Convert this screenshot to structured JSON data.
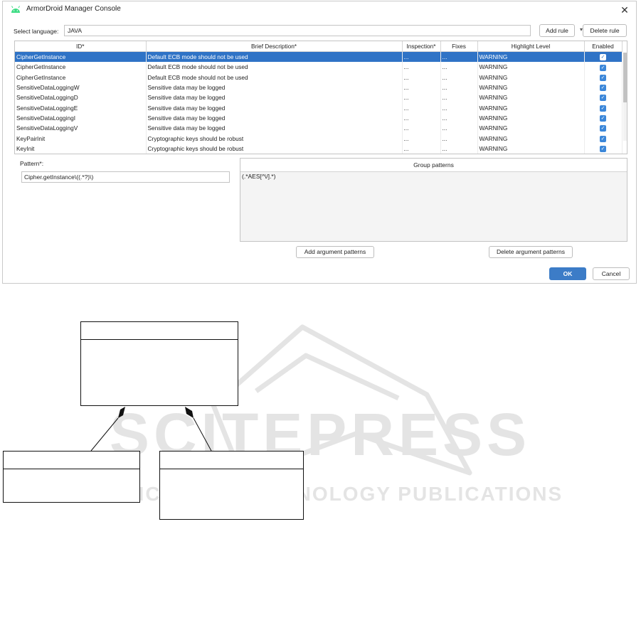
{
  "window": {
    "title": "ArmorDroid Manager Console",
    "close_glyph": "✕",
    "icon": "android-icon"
  },
  "language": {
    "label": "Select language:",
    "value": "JAVA",
    "dropdown_glyph": "▾"
  },
  "buttons": {
    "add_rule": "Add rule",
    "delete_rule": "Delete rule",
    "add_argument_patterns": "Add argument patterns",
    "delete_argument_patterns": "Delete argument patterns",
    "ok": "OK",
    "cancel": "Cancel"
  },
  "table": {
    "columns": [
      "ID*",
      "Brief Description*",
      "Inspection*",
      "Fixes",
      "Highlight Level",
      "Enabled"
    ],
    "rows": [
      {
        "id": "CipherGetInstance",
        "desc": "Default ECB mode should not be used",
        "inspection": "...",
        "fixes": "...",
        "level": "WARNING",
        "enabled": true,
        "selected": true
      },
      {
        "id": "CipherGetInstance",
        "desc": "Default ECB mode should not be used",
        "inspection": "...",
        "fixes": "...",
        "level": "WARNING",
        "enabled": true,
        "selected": false
      },
      {
        "id": "CipherGetInstance",
        "desc": "Default ECB mode should not be used",
        "inspection": "...",
        "fixes": "...",
        "level": "WARNING",
        "enabled": true,
        "selected": false
      },
      {
        "id": "SensitiveDataLoggingW",
        "desc": "Sensitive data may be logged",
        "inspection": "...",
        "fixes": "...",
        "level": "WARNING",
        "enabled": true,
        "selected": false
      },
      {
        "id": "SensitiveDataLoggingD",
        "desc": "Sensitive data may be logged",
        "inspection": "...",
        "fixes": "...",
        "level": "WARNING",
        "enabled": true,
        "selected": false
      },
      {
        "id": "SensitiveDataLoggingE",
        "desc": "Sensitive data may be logged",
        "inspection": "...",
        "fixes": "...",
        "level": "WARNING",
        "enabled": true,
        "selected": false
      },
      {
        "id": "SensitiveDataLoggingI",
        "desc": "Sensitive data may be logged",
        "inspection": "...",
        "fixes": "...",
        "level": "WARNING",
        "enabled": true,
        "selected": false
      },
      {
        "id": "SensitiveDataLoggingV",
        "desc": "Sensitive data may be logged",
        "inspection": "...",
        "fixes": "...",
        "level": "WARNING",
        "enabled": true,
        "selected": false
      },
      {
        "id": "KeyPairInit",
        "desc": "Cryptographic keys should be robust",
        "inspection": "...",
        "fixes": "...",
        "level": "WARNING",
        "enabled": true,
        "selected": false
      },
      {
        "id": "KeyInit",
        "desc": "Cryptographic keys should be robust",
        "inspection": "...",
        "fixes": "...",
        "level": "WARNING",
        "enabled": true,
        "selected": false
      }
    ]
  },
  "pattern": {
    "label": "Pattern*:",
    "value": "Cipher.getInstance\\((.*?)\\)"
  },
  "group_patterns": {
    "header": "Group patterns",
    "rows": [
      "(.*AES[^\\/].*)"
    ]
  },
  "watermark": {
    "line1": "SCITEPRESS",
    "line2": "SCIENCE AND TECHNOLOGY PUBLICATIONS"
  },
  "colors": {
    "accent": "#3c7cc7",
    "selection": "#2f73c6",
    "checkbox": "#3c87d9",
    "watermark": "#e4e4e4"
  }
}
